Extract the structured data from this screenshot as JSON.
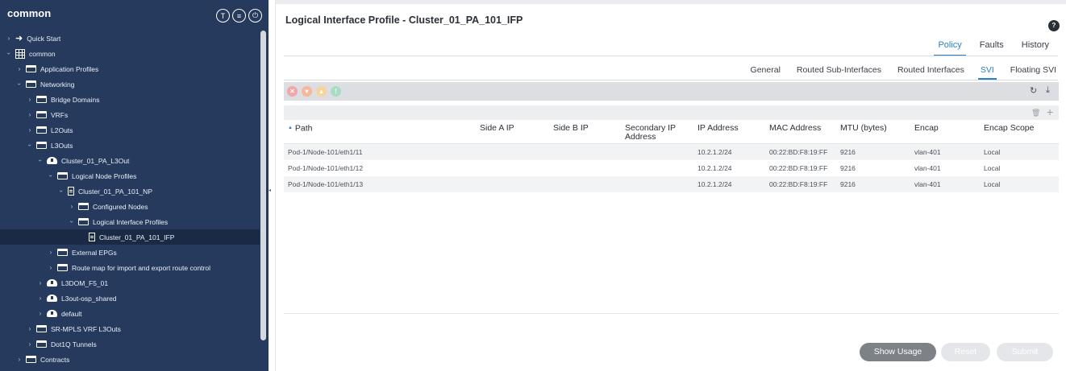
{
  "sidebar": {
    "title": "common",
    "header_icons": [
      {
        "name": "pin-icon",
        "glyph": "T"
      },
      {
        "name": "list-icon",
        "glyph": "≡"
      },
      {
        "name": "power-icon",
        "glyph": "⏻"
      }
    ],
    "tree": [
      {
        "label": "Quick Start",
        "indent": 0,
        "icon": "quickstart-icon",
        "expanded": false
      },
      {
        "label": "common",
        "indent": 0,
        "icon": "tenant-grid-icon",
        "expanded": true
      },
      {
        "label": "Application Profiles",
        "indent": 1,
        "icon": "folder-icon",
        "expanded": false
      },
      {
        "label": "Networking",
        "indent": 1,
        "icon": "folder-icon",
        "expanded": true
      },
      {
        "label": "Bridge Domains",
        "indent": 2,
        "icon": "folder-icon",
        "expanded": false
      },
      {
        "label": "VRFs",
        "indent": 2,
        "icon": "folder-icon",
        "expanded": false
      },
      {
        "label": "L2Outs",
        "indent": 2,
        "icon": "folder-icon",
        "expanded": false
      },
      {
        "label": "L3Outs",
        "indent": 2,
        "icon": "folder-icon",
        "expanded": true
      },
      {
        "label": "Cluster_01_PA_L3Out",
        "indent": 3,
        "icon": "cloud-icon",
        "expanded": true
      },
      {
        "label": "Logical Node Profiles",
        "indent": 4,
        "icon": "folder-icon",
        "expanded": true
      },
      {
        "label": "Cluster_01_PA_101_NP",
        "indent": 5,
        "icon": "document-icon",
        "expanded": true
      },
      {
        "label": "Configured Nodes",
        "indent": 6,
        "icon": "folder-icon",
        "expanded": false
      },
      {
        "label": "Logical Interface Profiles",
        "indent": 6,
        "icon": "folder-icon",
        "expanded": true
      },
      {
        "label": "Cluster_01_PA_101_IFP",
        "indent": 7,
        "icon": "document-icon",
        "expanded": null,
        "selected": true
      },
      {
        "label": "External EPGs",
        "indent": 4,
        "icon": "folder-icon",
        "expanded": false
      },
      {
        "label": "Route map for import and export route control",
        "indent": 4,
        "icon": "folder-icon",
        "expanded": false
      },
      {
        "label": "L3DOM_F5_01",
        "indent": 3,
        "icon": "cloud-icon",
        "expanded": false
      },
      {
        "label": "L3out-osp_shared",
        "indent": 3,
        "icon": "cloud-icon",
        "expanded": false
      },
      {
        "label": "default",
        "indent": 3,
        "icon": "cloud-icon",
        "expanded": false
      },
      {
        "label": "SR-MPLS VRF L3Outs",
        "indent": 2,
        "icon": "folder-icon",
        "expanded": false
      },
      {
        "label": "Dot1Q Tunnels",
        "indent": 2,
        "icon": "folder-icon",
        "expanded": false
      },
      {
        "label": "Contracts",
        "indent": 1,
        "icon": "folder-icon",
        "expanded": false
      }
    ]
  },
  "main": {
    "title": "Logical Interface Profile - Cluster_01_PA_101_IFP",
    "top_tabs": [
      {
        "label": "Policy",
        "active": true
      },
      {
        "label": "Faults",
        "active": false
      },
      {
        "label": "History",
        "active": false
      }
    ],
    "sub_tabs": [
      {
        "label": "General",
        "active": false
      },
      {
        "label": "Routed Sub-Interfaces",
        "active": false
      },
      {
        "label": "Routed Interfaces",
        "active": false
      },
      {
        "label": "SVI",
        "active": true
      },
      {
        "label": "Floating SVI",
        "active": false
      }
    ],
    "action_icons": [
      {
        "name": "critical-fault-icon",
        "color": "#f4a5a8"
      },
      {
        "name": "major-fault-icon",
        "color": "#f6b89a"
      },
      {
        "name": "minor-fault-icon",
        "color": "#f7d49a"
      },
      {
        "name": "warning-fault-icon",
        "color": "#a9dcc5"
      }
    ],
    "action_right": {
      "refresh": "↻",
      "download": "⤓"
    },
    "table_tools": {
      "delete": "🗑",
      "add": "+"
    },
    "table": {
      "columns": [
        "Path",
        "Side A IP",
        "Side B IP",
        "Secondary IP Address",
        "IP Address",
        "MAC Address",
        "MTU (bytes)",
        "Encap",
        "Encap Scope"
      ],
      "sort_indicator": "▲",
      "rows": [
        [
          "Pod-1/Node-101/eth1/11",
          "",
          "",
          "",
          "10.2.1.2/24",
          "00:22:BD:F8:19:FF",
          "9216",
          "vlan-401",
          "Local"
        ],
        [
          "Pod-1/Node-101/eth1/12",
          "",
          "",
          "",
          "10.2.1.2/24",
          "00:22:BD:F8:19:FF",
          "9216",
          "vlan-401",
          "Local"
        ],
        [
          "Pod-1/Node-101/eth1/13",
          "",
          "",
          "",
          "10.2.1.2/24",
          "00:22:BD:F8:19:FF",
          "9216",
          "vlan-401",
          "Local"
        ]
      ]
    },
    "buttons": {
      "show_usage": "Show Usage",
      "reset": "Reset",
      "submit": "Submit"
    }
  }
}
